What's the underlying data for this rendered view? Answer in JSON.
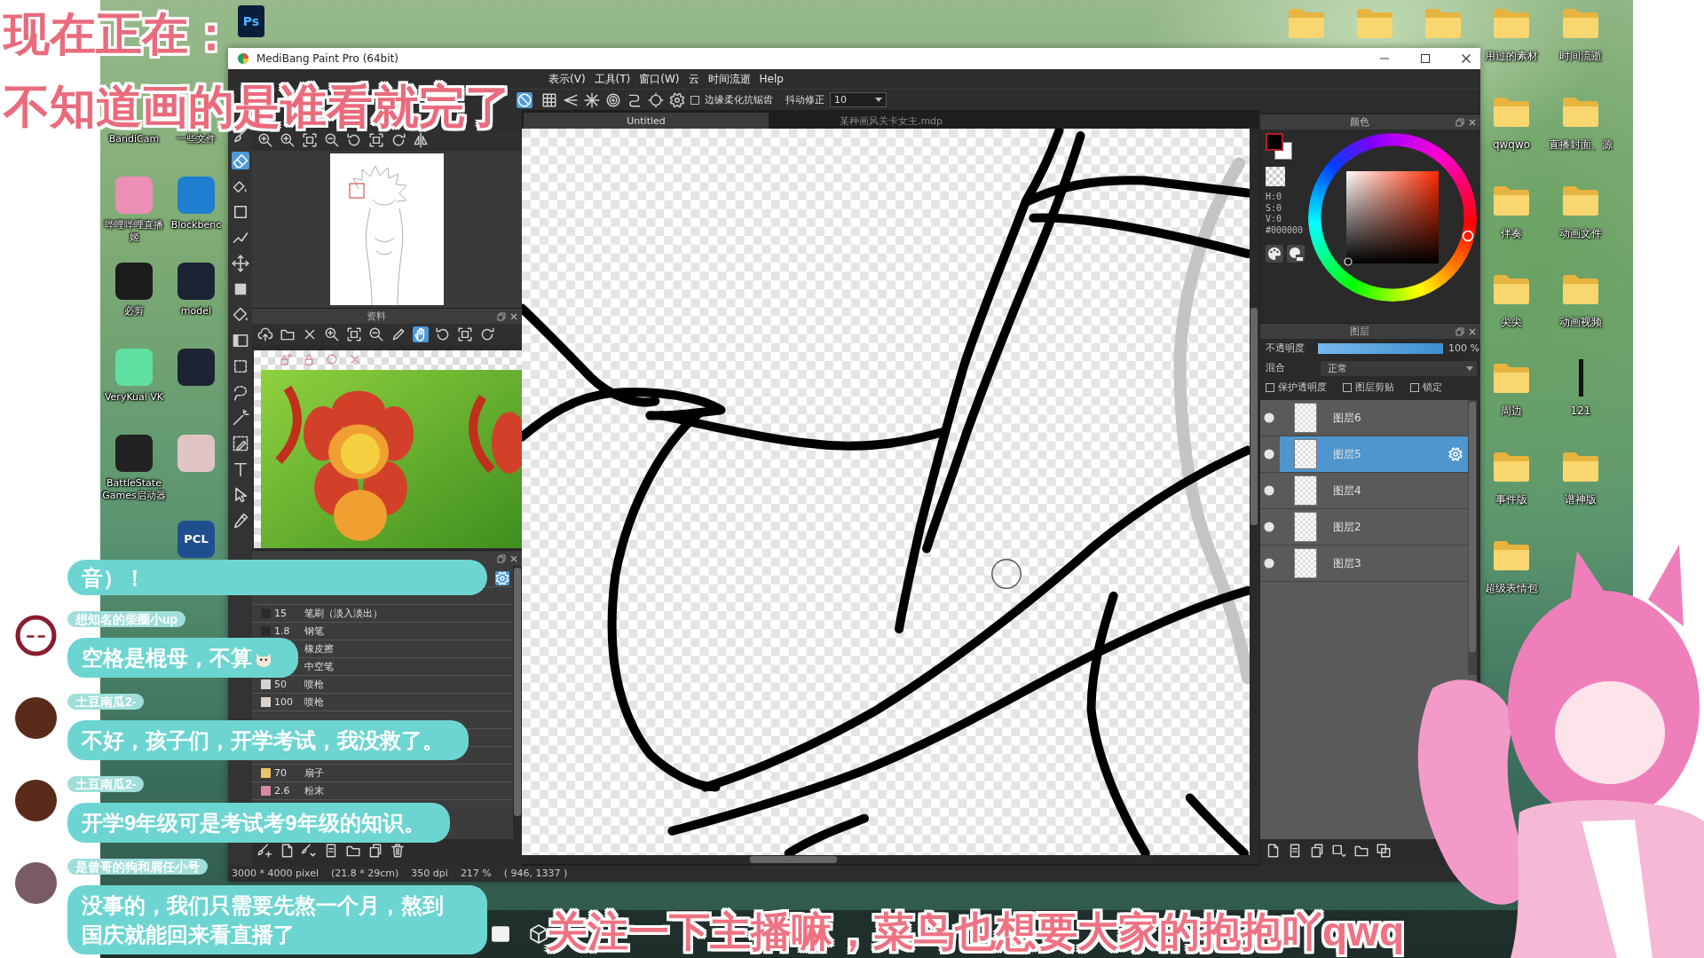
{
  "caption": {
    "lines": [
      "现在正在：",
      "不知道画的是谁看就完了"
    ]
  },
  "desktop": {
    "app_tile": {
      "logo": "Ps"
    },
    "top_folders": [
      {
        "kind": "folder"
      },
      {
        "kind": "folder"
      },
      {
        "kind": "folder"
      }
    ],
    "left_icon_columns": [
      [
        {
          "kind": "label",
          "label": "BandiCam"
        },
        {
          "kind": "tile",
          "color": "#ec8fb5",
          "label": "哔哩哔哩直播姬"
        },
        {
          "kind": "tile",
          "color": "#1c1c1c",
          "label": "必剪"
        },
        {
          "kind": "tile",
          "color": "#5fe0a0",
          "label": "VeryKuai VK"
        },
        {
          "kind": "tile",
          "color": "#222222",
          "label": "BattleState Games启动器"
        }
      ],
      [
        {
          "kind": "label",
          "label": "一些文件"
        },
        {
          "kind": "tile",
          "color": "#1e7fd0",
          "label": "Blockbenc"
        },
        {
          "kind": "tile",
          "color": "#1c2433",
          "label": "model"
        },
        {
          "kind": "tile",
          "color": "#1c2433"
        },
        {
          "kind": "tile",
          "color": "#e0c4c4"
        },
        {
          "kind": "logo",
          "color": "#1f4f8f",
          "label": "PCL"
        }
      ]
    ],
    "right_icons": [
      {
        "kind": "folder",
        "label": "用过的素材"
      },
      {
        "kind": "folder",
        "label": "时间流逝"
      },
      {
        "kind": "folder",
        "label": "qwqwo"
      },
      {
        "kind": "folder",
        "label": "直播封面、源"
      },
      {
        "kind": "folder",
        "label": "伴奏"
      },
      {
        "kind": "folder",
        "label": "动画文件"
      },
      {
        "kind": "folder",
        "label": "尖尖"
      },
      {
        "kind": "folder",
        "label": "动画视频"
      },
      {
        "kind": "folder",
        "label": "周边"
      },
      {
        "kind": "file",
        "label": "121"
      },
      {
        "kind": "folder",
        "label": "事件版"
      },
      {
        "kind": "folder",
        "label": "谱神版"
      },
      {
        "kind": "folder",
        "label": "超级表情包"
      }
    ],
    "taskbar": [
      {
        "kind": "square"
      },
      {
        "kind": "cube"
      }
    ]
  },
  "app_window": {
    "title": "MediBang Paint Pro (64bit)",
    "menu": [
      "表示(V)",
      "工具(T)",
      "窗口(W)",
      "云",
      "时间流逝",
      "Help"
    ],
    "toolbar": {
      "tools": [
        {
          "kind": "no-snap",
          "selected": true
        },
        {
          "kind": "grid",
          "selected": false
        },
        {
          "kind": "perspective",
          "selected": false
        },
        {
          "kind": "radial",
          "selected": false
        },
        {
          "kind": "concentric",
          "selected": false
        },
        {
          "kind": "curve",
          "selected": false
        },
        {
          "kind": "ring",
          "selected": false
        },
        {
          "kind": "gear",
          "selected": false
        }
      ],
      "antialias": {
        "label": "边缘柔化抗锯齿",
        "checked": false
      },
      "stabilizer": {
        "label": "抖动修正",
        "value": "10"
      }
    },
    "tool_strip": [
      {
        "kind": "brush",
        "selected": false
      },
      {
        "kind": "eraser",
        "selected": true
      },
      {
        "kind": "fill-eraser",
        "selected": false
      },
      {
        "kind": "rectangle",
        "selected": false
      },
      {
        "kind": "polyline",
        "selected": false
      },
      {
        "kind": "move",
        "selected": false
      },
      {
        "kind": "square",
        "selected": false
      },
      {
        "kind": "bucket",
        "selected": false
      },
      {
        "kind": "gradient",
        "selected": false
      },
      {
        "kind": "select-rect",
        "selected": false
      },
      {
        "kind": "lasso",
        "selected": false
      },
      {
        "kind": "magic-wand",
        "selected": false
      },
      {
        "kind": "select-pen",
        "selected": false
      },
      {
        "kind": "text",
        "selected": false
      },
      {
        "kind": "pointer",
        "selected": false
      },
      {
        "kind": "eyedropper",
        "selected": false
      }
    ],
    "navigator": {
      "toolbar": [
        {
          "kind": "zoom-in"
        },
        {
          "kind": "zoom-in"
        },
        {
          "kind": "fit-screen"
        },
        {
          "kind": "zoom-out"
        },
        {
          "kind": "rotate-left"
        },
        {
          "kind": "fit-screen"
        },
        {
          "kind": "rotate-right"
        },
        {
          "kind": "flip"
        }
      ]
    },
    "material_panel": {
      "title": "资料",
      "toolbar": [
        {
          "kind": "cloud-upload",
          "selected": false
        },
        {
          "kind": "folder",
          "selected": false
        },
        {
          "kind": "close",
          "selected": false
        },
        {
          "kind": "zoom-in",
          "selected": false
        },
        {
          "kind": "fit-screen",
          "selected": false
        },
        {
          "kind": "zoom-out",
          "selected": false
        },
        {
          "kind": "pen",
          "selected": false
        },
        {
          "kind": "hand",
          "selected": true
        },
        {
          "kind": "rotate-left",
          "selected": false
        },
        {
          "kind": "fit-screen",
          "selected": false
        },
        {
          "kind": "rotate-right",
          "selected": false
        }
      ],
      "actions": [
        {
          "kind": "lock-add"
        },
        {
          "kind": "lock"
        },
        {
          "kind": "circle"
        },
        {
          "kind": "close"
        }
      ]
    },
    "brush_panel": {
      "groups": [
        {
          "rows": [
            {
              "size": "15",
              "name": "笔刷（淡入淡出）",
              "color": "#2b2b2b"
            },
            {
              "size": "1.8",
              "name": "钢笔",
              "color": "#2b2b2b"
            },
            {
              "name": "橡皮擦"
            },
            {
              "name": "中空笔"
            },
            {
              "size": "50",
              "name": "喷枪",
              "color": "#d2d2d2"
            },
            {
              "size": "100",
              "name": "喷枪",
              "color": "#dcd2cc"
            }
          ]
        },
        {
          "rows": [
            {
              "size": "70",
              "name": "扇子",
              "color": "#e9c46a"
            },
            {
              "size": "2.6",
              "name": "粉末",
              "color": "#d98aa0"
            }
          ]
        }
      ],
      "toolbar": [
        {
          "kind": "brush-add"
        },
        {
          "kind": "new-page"
        },
        {
          "kind": "brush-menu"
        },
        {
          "kind": "document"
        },
        {
          "kind": "folder"
        },
        {
          "kind": "copy"
        },
        {
          "kind": "trash"
        }
      ]
    },
    "tabs": [
      {
        "label": "Untitled",
        "selected": true
      },
      {
        "label": "某种画风关卡女主.mdp",
        "selected": false
      }
    ],
    "status_bar": [
      "3000 * 4000 pixel",
      "(21.8 * 29cm)",
      "350 dpi",
      "217 %",
      "( 946, 1337 )"
    ],
    "color_panel": {
      "title": "颜色",
      "foreground": {
        "color": "#000000"
      },
      "background": {
        "color": "#ffffff"
      },
      "values": [
        "H:0",
        "S:0",
        "V:0",
        "#000000"
      ]
    },
    "layer_panel": {
      "title": "图层",
      "opacity": {
        "label": "不透明度",
        "level": 1,
        "reading": "100 %"
      },
      "blend": {
        "label": "混合",
        "value": "正常"
      },
      "options": [
        {
          "label": "保护透明度",
          "checked": false
        },
        {
          "label": "图层剪贴",
          "checked": false
        },
        {
          "label": "锁定",
          "checked": false
        }
      ],
      "layers": [
        {
          "name": "图层6",
          "selected": false,
          "visible": true
        },
        {
          "name": "图层5",
          "selected": true,
          "visible": true
        },
        {
          "name": "图层4",
          "selected": false,
          "visible": true
        },
        {
          "name": "图层2",
          "selected": false,
          "visible": true
        },
        {
          "name": "图层3",
          "selected": false,
          "visible": true
        }
      ],
      "toolbar": [
        {
          "kind": "new-page"
        },
        {
          "kind": "document"
        },
        {
          "kind": "copy"
        },
        {
          "kind": "layer-menu"
        },
        {
          "kind": "folder"
        },
        {
          "kind": "merge"
        }
      ]
    }
  },
  "chat": [
    {
      "kind": "tail",
      "text": "音）！"
    },
    {
      "kind": "message",
      "user": "想知名的柴圈小up",
      "avatar": {
        "kind": "ring",
        "color": "#8a1c2c"
      },
      "text": "空格是棍母，不算",
      "emoji": true
    },
    {
      "kind": "message",
      "user": "土豆南瓜2-",
      "avatar": {
        "kind": "disc",
        "color": "#5a2a1a"
      },
      "text": "不好，孩子们，开学考试，我没救了。"
    },
    {
      "kind": "message",
      "user": "土豆南瓜2-",
      "avatar": {
        "kind": "disc",
        "color": "#5a2a1a"
      },
      "text": "开学9年级可是考试考9年级的知识。"
    },
    {
      "kind": "message",
      "user": "是曾哥的狗和屑任小号",
      "avatar": {
        "kind": "disc",
        "color": "#7a5a66"
      },
      "text": "没事的，我们只需要先熬一个月，熬到国庆就能回来看直播了"
    }
  ],
  "subtitle": "关注一下主播嘛，菜鸟也想要大家的抱抱吖qwq"
}
